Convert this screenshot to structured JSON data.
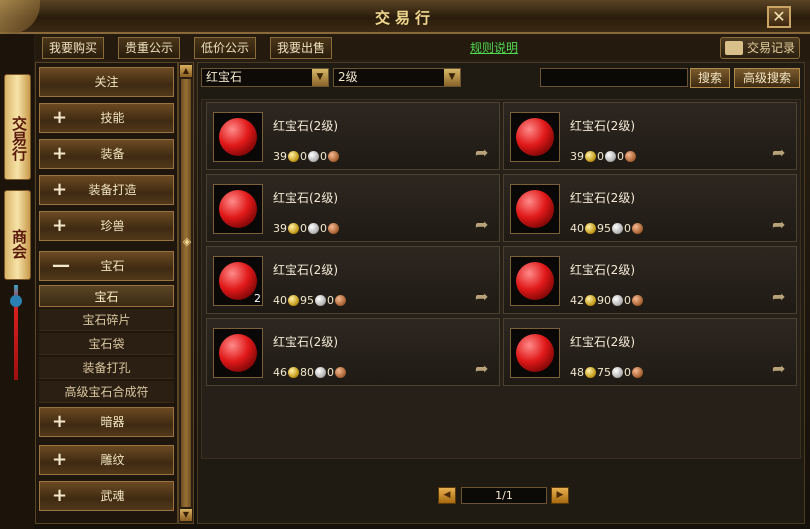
{
  "window": {
    "title": "交易行",
    "close": "✕"
  },
  "top_tabs": [
    {
      "label": "我要购买"
    },
    {
      "label": "贵重公示"
    },
    {
      "label": "低价公示"
    },
    {
      "label": "我要出售"
    }
  ],
  "rules_link": "规则说明",
  "trade_record": "交易记录",
  "side_tabs": [
    {
      "label": "交易行"
    },
    {
      "label": "商会"
    }
  ],
  "categories": [
    {
      "sign": "",
      "label": "关注"
    },
    {
      "sign": "+",
      "label": "技能"
    },
    {
      "sign": "+",
      "label": "装备"
    },
    {
      "sign": "+",
      "label": "装备打造"
    },
    {
      "sign": "+",
      "label": "珍兽"
    },
    {
      "sign": "—",
      "label": "宝石"
    }
  ],
  "subcategories": [
    {
      "label": "宝石"
    },
    {
      "label": "宝石碎片"
    },
    {
      "label": "宝石袋"
    },
    {
      "label": "装备打孔"
    },
    {
      "label": "高级宝石合成符"
    }
  ],
  "categories_bottom": [
    {
      "sign": "+",
      "label": "暗器"
    },
    {
      "sign": "+",
      "label": "雕纹"
    },
    {
      "sign": "+",
      "label": "武魂"
    }
  ],
  "filters": {
    "item": "红宝石",
    "level": "2级",
    "search_value": ""
  },
  "buttons": {
    "search": "搜索",
    "advanced_search": "高级搜索"
  },
  "listings": [
    {
      "name": "红宝石(2级)",
      "count": "",
      "gold": "39",
      "silver": "0",
      "copper": "0"
    },
    {
      "name": "红宝石(2级)",
      "count": "",
      "gold": "39",
      "silver": "0",
      "copper": "0"
    },
    {
      "name": "红宝石(2级)",
      "count": "",
      "gold": "39",
      "silver": "0",
      "copper": "0"
    },
    {
      "name": "红宝石(2级)",
      "count": "",
      "gold": "40",
      "silver": "95",
      "copper": "0"
    },
    {
      "name": "红宝石(2级)",
      "count": "2",
      "gold": "40",
      "silver": "95",
      "copper": "0"
    },
    {
      "name": "红宝石(2级)",
      "count": "",
      "gold": "42",
      "silver": "90",
      "copper": "0"
    },
    {
      "name": "红宝石(2级)",
      "count": "",
      "gold": "46",
      "silver": "80",
      "copper": "0"
    },
    {
      "name": "红宝石(2级)",
      "count": "",
      "gold": "48",
      "silver": "75",
      "copper": "0"
    }
  ],
  "pager": {
    "text": "1/1"
  },
  "colors": {
    "accent": "#f0d890",
    "link": "#4fd94f",
    "gem": "#e01818"
  }
}
